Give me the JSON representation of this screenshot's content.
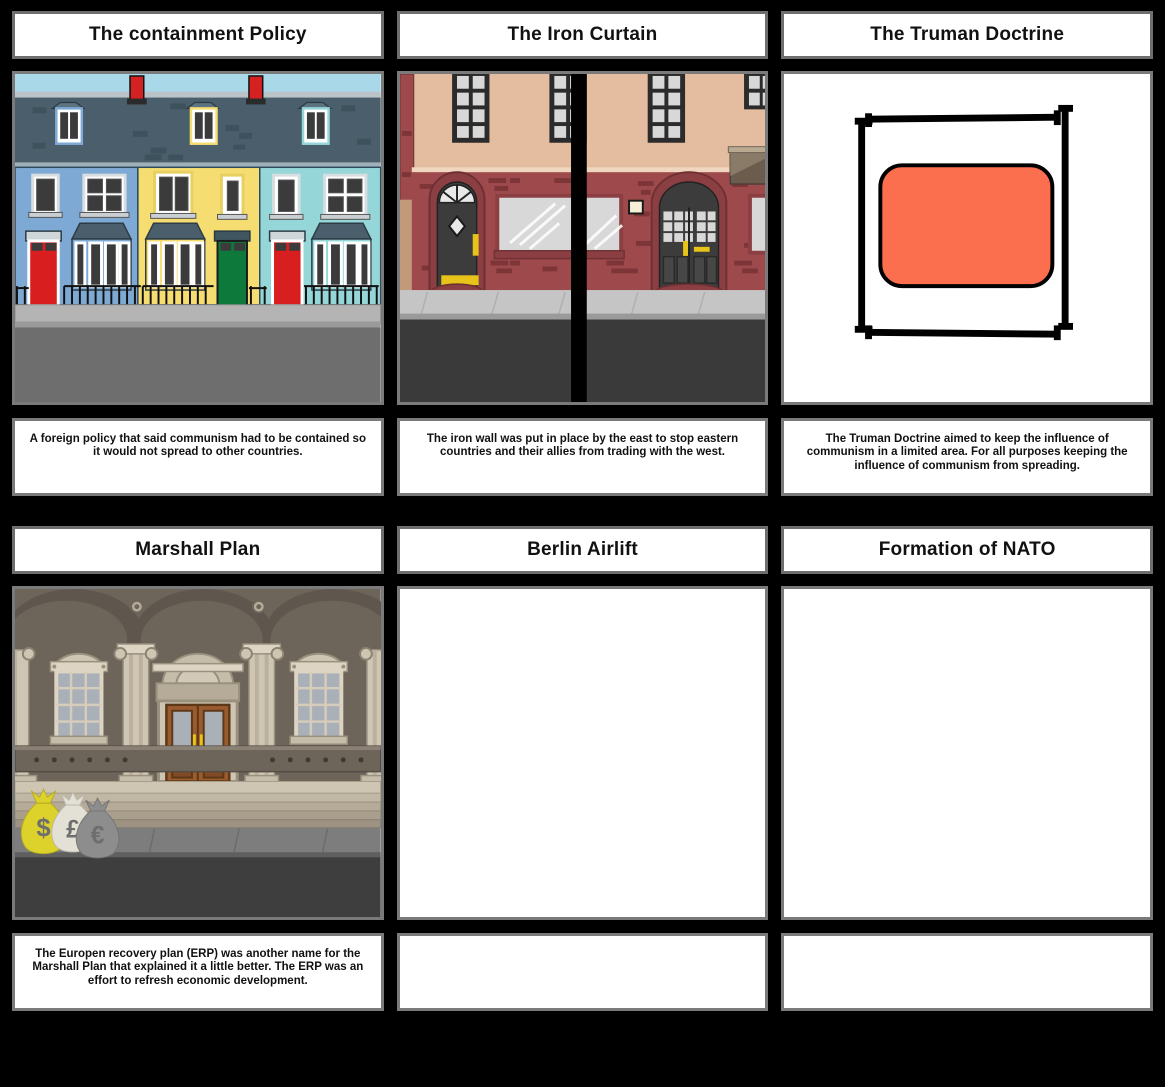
{
  "board": {
    "background_color": "#000000",
    "card_background": "#ffffff",
    "card_border_color": "#7a7a7a",
    "text_color": "#111111"
  },
  "cells": [
    {
      "title": "The containment Policy",
      "caption": "A foreign policy that said communism had to be contained so it would not spread to other countries.",
      "illustration": "terraced-houses-street-scene",
      "illustration_colors": {
        "sky": "#a9d8e8",
        "roof": "#4a5f6b",
        "house_left": "#7ea9d4",
        "house_middle": "#f6dd72",
        "house_right": "#95d6d8",
        "door_red": "#d81e1e",
        "door_green": "#0d7a3c",
        "chimney": "#d42121",
        "pavement": "#b4b4b4",
        "road": "#6e6e6e"
      }
    },
    {
      "title": "The Iron Curtain",
      "caption": "The iron wall was put in place by the east to stop eastern countries and their allies from trading with the west.",
      "illustration": "brick-shopfront-split-by-black-barrier",
      "illustration_colors": {
        "upper_wall": "#e4bda0",
        "brick_wall": "#9e4a4d",
        "window_frame": "#2b2b2b",
        "glass": "#d8d8d8",
        "door_dark": "#3c3c3c",
        "accent_yellow": "#e8c319",
        "pavement": "#c5c5c5",
        "road": "#3a3a3a",
        "barrier": "#000000"
      }
    },
    {
      "title": "The Truman Doctrine",
      "caption": "The Truman Doctrine aimed to keep the influence of communism in a limited area.  For all purposes keeping the influence of communism from spreading.",
      "illustration": "containment-bracket-frame-with-orange-rectangle",
      "illustration_colors": {
        "background": "#ffffff",
        "frame": "#000000",
        "shape_fill": "#fc6f4e"
      }
    },
    {
      "title": "Marshall Plan",
      "caption": "The Europen recovery plan (ERP) was another name for the Marshall Plan that explained it a little better.  The ERP  was an effort to refresh economic development.",
      "illustration": "classical-bank-building-with-money-bags",
      "illustration_colors": {
        "stone_light": "#d3c9b8",
        "stone_mid": "#b6ab99",
        "stone_dark": "#6d645a",
        "arch_shadow": "#5f574e",
        "door_wood": "#9a5c2e",
        "glass": "#aab0b8",
        "bag_dollar": "#ddd22b",
        "bag_pound": "#e3e0d5",
        "bag_euro": "#8d8d8d",
        "pavement": "#7d7d7d",
        "road": "#3e3e3e"
      }
    },
    {
      "title": "Berlin Airlift",
      "caption": "",
      "illustration": "empty-panel",
      "illustration_colors": {
        "background": "#ffffff"
      }
    },
    {
      "title": "Formation of NATO",
      "caption": "",
      "illustration": "empty-panel",
      "illustration_colors": {
        "background": "#ffffff"
      }
    }
  ]
}
